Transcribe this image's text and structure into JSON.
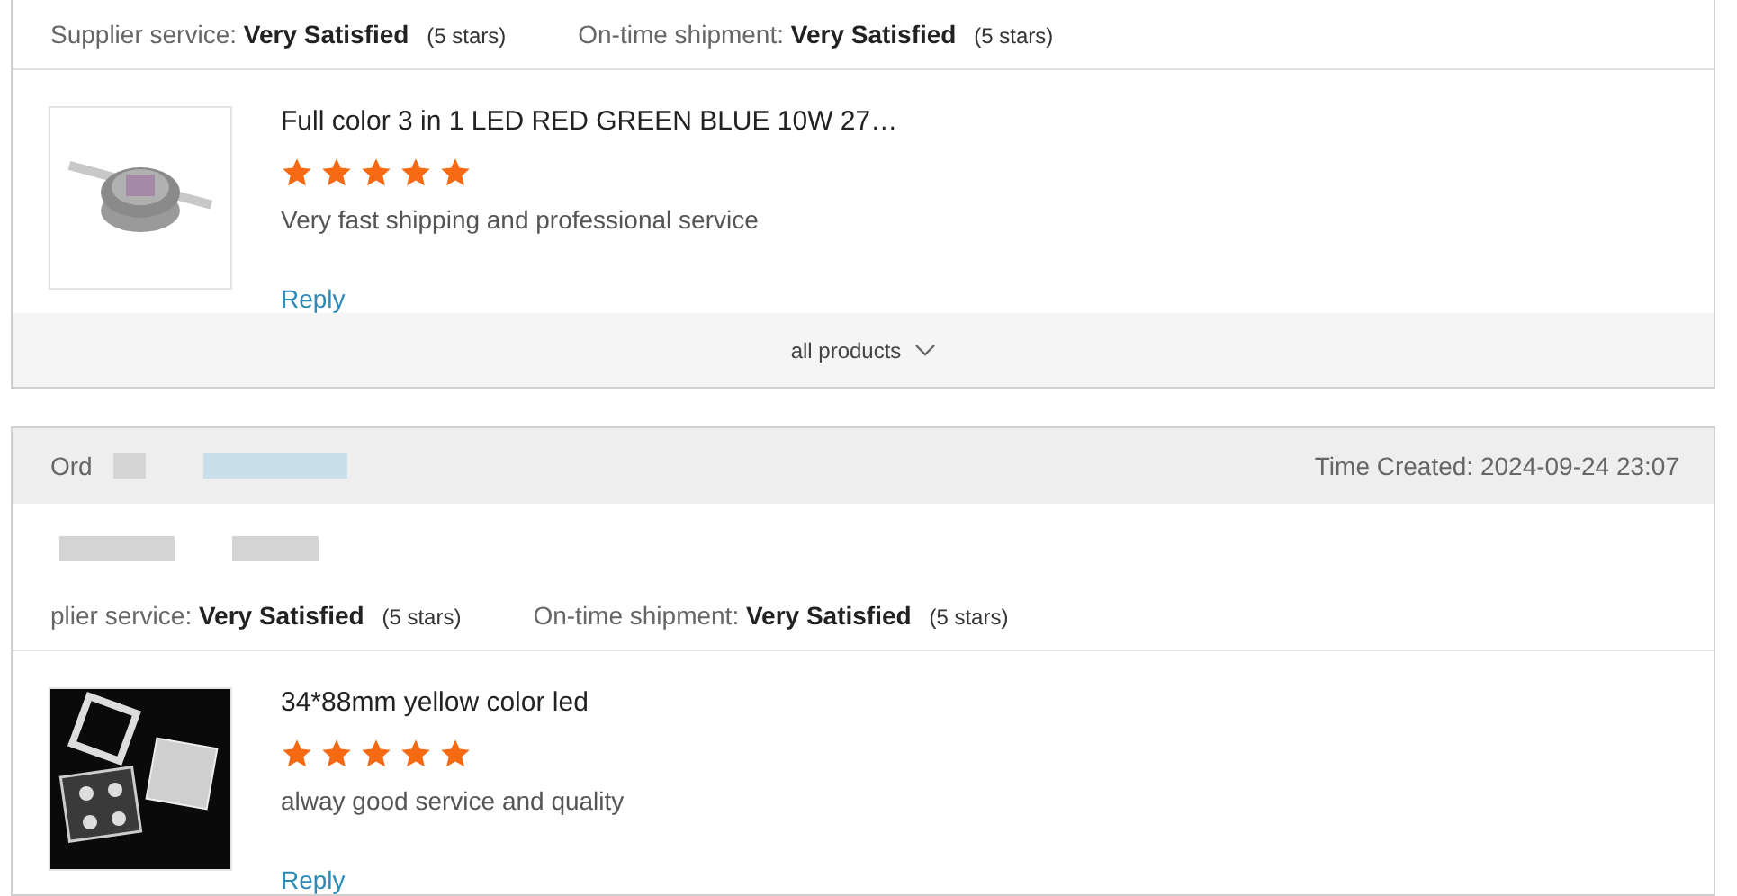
{
  "orders": [
    {
      "ratings": [
        {
          "label": "Supplier service:",
          "value": "Very Satisfied",
          "note": "(5 stars)"
        },
        {
          "label": "On-time shipment:",
          "value": "Very Satisfied",
          "note": "(5 stars)"
        }
      ],
      "products": [
        {
          "title": "Full color 3 in 1 LED RED GREEN BLUE 10W 27…",
          "stars": 5,
          "review": "Very fast shipping and professional service",
          "reply": "Reply"
        }
      ],
      "footer": "all products"
    },
    {
      "order_label": "Ord",
      "time_created": "Time Created: 2024-09-24 23:07",
      "ratings": [
        {
          "label": "plier service:",
          "value": "Very Satisfied",
          "note": "(5 stars)"
        },
        {
          "label": "On-time shipment:",
          "value": "Very Satisfied",
          "note": "(5 stars)"
        }
      ],
      "products": [
        {
          "title": "34*88mm yellow color led",
          "stars": 5,
          "review": "alway good service and quality",
          "reply": "Reply"
        }
      ]
    }
  ]
}
